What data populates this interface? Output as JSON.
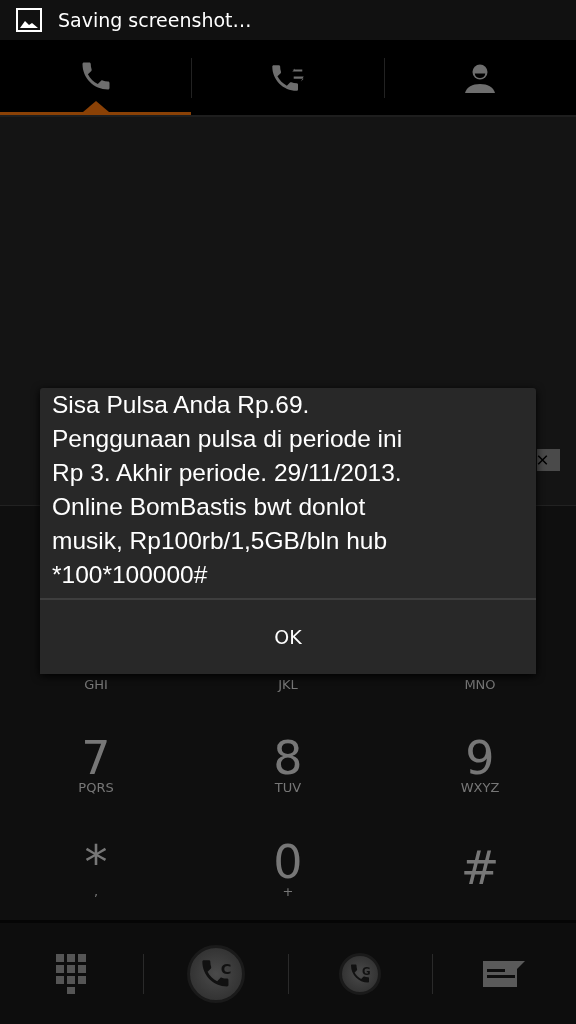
{
  "status_bar": {
    "notification": "Saving screenshot…"
  },
  "tabs": [
    {
      "kind": "phone",
      "selected": true
    },
    {
      "kind": "log",
      "selected": false
    },
    {
      "kind": "contacts",
      "selected": false
    }
  ],
  "keypad": [
    {
      "letters": "GHI"
    },
    {
      "letters": "JKL"
    },
    {
      "letters": "MNO"
    },
    {
      "digit": "7",
      "letters": "PQRS"
    },
    {
      "digit": "8",
      "letters": "TUV"
    },
    {
      "digit": "9",
      "letters": "WXYZ"
    },
    {
      "digit": "*",
      "letters": ","
    },
    {
      "digit": "0",
      "letters": "+"
    },
    {
      "digit": "#"
    }
  ],
  "bottom_bar": [
    {
      "kind": "dialpad"
    },
    {
      "kind": "call",
      "label": "C"
    },
    {
      "kind": "call-small",
      "label": "G"
    },
    {
      "kind": "message"
    }
  ],
  "dialog": {
    "message": "Sisa Pulsa Anda Rp.69.\nPenggunaan pulsa di periode ini\nRp 3. Akhir periode. 29/11/2013.\nOnline BomBastis bwt donlot\nmusik, Rp100rb/1,5GB/bln hub\n*100*100000#",
    "button": "OK"
  }
}
